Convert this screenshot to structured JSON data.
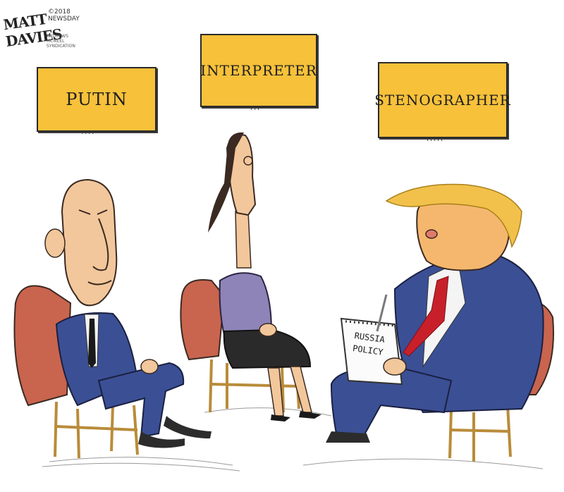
{
  "signature": {
    "artist": "MATT DAVIES",
    "copyright": "©2018 NEWSDAY",
    "syndicate": "ANDREWS MCMEEL SYNDICATION"
  },
  "signs": {
    "putin": "PUTIN",
    "interpreter": "INTERPRETER",
    "stenographer": "STENOGRAPHER"
  },
  "notepad": {
    "line1": "RUSSIA",
    "line2": "POLICY"
  },
  "colors": {
    "sign": "#f7c13a",
    "suit": "#3b4f95",
    "tie": "#c8202a",
    "chair": "#c9644e",
    "hair": "#f2c14b",
    "skin": "#f2c79b",
    "blouse": "#8e84b8"
  }
}
